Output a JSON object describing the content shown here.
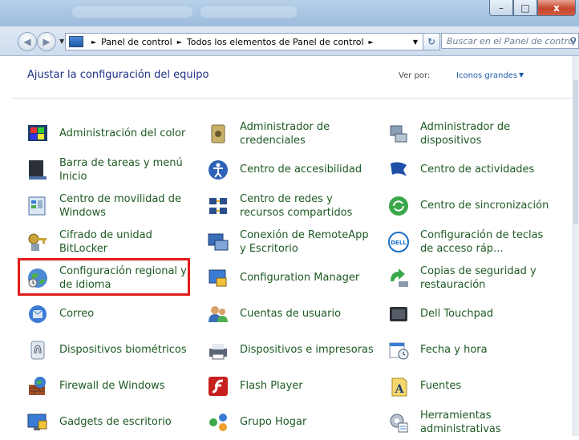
{
  "window": {
    "minimize_symbol": "–",
    "maximize_symbol": "□",
    "close_symbol": "x"
  },
  "address": {
    "crumbs": [
      "Panel de control",
      "Todos los elementos de Panel de control"
    ],
    "separator": "►"
  },
  "search": {
    "placeholder": "Buscar en el Panel de control"
  },
  "header": {
    "title": "Ajustar la configuración del equipo",
    "view_by_label": "Ver por:",
    "view_by_value": "Iconos grandes"
  },
  "items": [
    {
      "label": "Administración del color",
      "icon": "color-management-icon"
    },
    {
      "label": "Administrador de credenciales",
      "icon": "credential-manager-icon"
    },
    {
      "label": "Administrador de dispositivos",
      "icon": "device-manager-icon"
    },
    {
      "label": "Barra de tareas y menú Inicio",
      "icon": "taskbar-icon"
    },
    {
      "label": "Centro de accesibilidad",
      "icon": "accessibility-icon"
    },
    {
      "label": "Centro de actividades",
      "icon": "action-center-flag-icon"
    },
    {
      "label": "Centro de movilidad de Windows",
      "icon": "mobility-center-icon"
    },
    {
      "label": "Centro de redes y recursos compartidos",
      "icon": "network-center-icon"
    },
    {
      "label": "Centro de sincronización",
      "icon": "sync-center-icon"
    },
    {
      "label": "Cifrado de unidad BitLocker",
      "icon": "bitlocker-key-icon"
    },
    {
      "label": "Conexión de RemoteApp y Escritorio",
      "icon": "remoteapp-icon"
    },
    {
      "label": "Configuración de teclas de acceso ráp...",
      "icon": "dell-icon"
    },
    {
      "label": "Configuración regional y de idioma",
      "icon": "region-language-globe-icon"
    },
    {
      "label": "Configuration Manager",
      "icon": "configuration-manager-icon"
    },
    {
      "label": "Copias de seguridad y restauración",
      "icon": "backup-restore-icon"
    },
    {
      "label": "Correo",
      "icon": "mail-icon"
    },
    {
      "label": "Cuentas de usuario",
      "icon": "user-accounts-icon"
    },
    {
      "label": "Dell Touchpad",
      "icon": "touchpad-icon"
    },
    {
      "label": "Dispositivos biométricos",
      "icon": "fingerprint-icon"
    },
    {
      "label": "Dispositivos e impresoras",
      "icon": "printer-icon"
    },
    {
      "label": "Fecha y hora",
      "icon": "date-time-icon"
    },
    {
      "label": "Firewall de Windows",
      "icon": "firewall-icon"
    },
    {
      "label": "Flash Player",
      "icon": "flash-player-icon"
    },
    {
      "label": "Fuentes",
      "icon": "fonts-icon"
    },
    {
      "label": "Gadgets de escritorio",
      "icon": "desktop-gadgets-icon"
    },
    {
      "label": "Grupo Hogar",
      "icon": "homegroup-icon"
    },
    {
      "label": "Herramientas administrativas",
      "icon": "admin-tools-icon"
    }
  ],
  "colors": {
    "link_text": "#1d5a23",
    "heading": "#1e3287",
    "highlight": "#e31b1b"
  }
}
